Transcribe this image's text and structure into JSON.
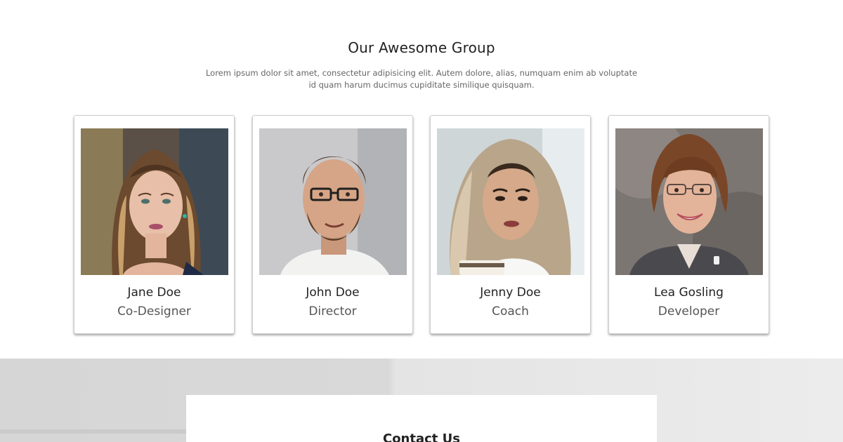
{
  "section": {
    "title": "Our Awesome Group",
    "subtitle_line1": "Lorem ipsum dolor sit amet, consectetur adipisicing elit. Autem dolore, alias, numquam enim ab voluptate",
    "subtitle_line2": "id quam harum ducimus cupiditate similique quisquam."
  },
  "members": [
    {
      "name": "Jane Doe",
      "role": "Co-Designer"
    },
    {
      "name": "John Doe",
      "role": "Director"
    },
    {
      "name": "Jenny Doe",
      "role": "Coach"
    },
    {
      "name": "Lea Gosling",
      "role": "Developer"
    }
  ],
  "contact": {
    "title": "Contact Us"
  }
}
